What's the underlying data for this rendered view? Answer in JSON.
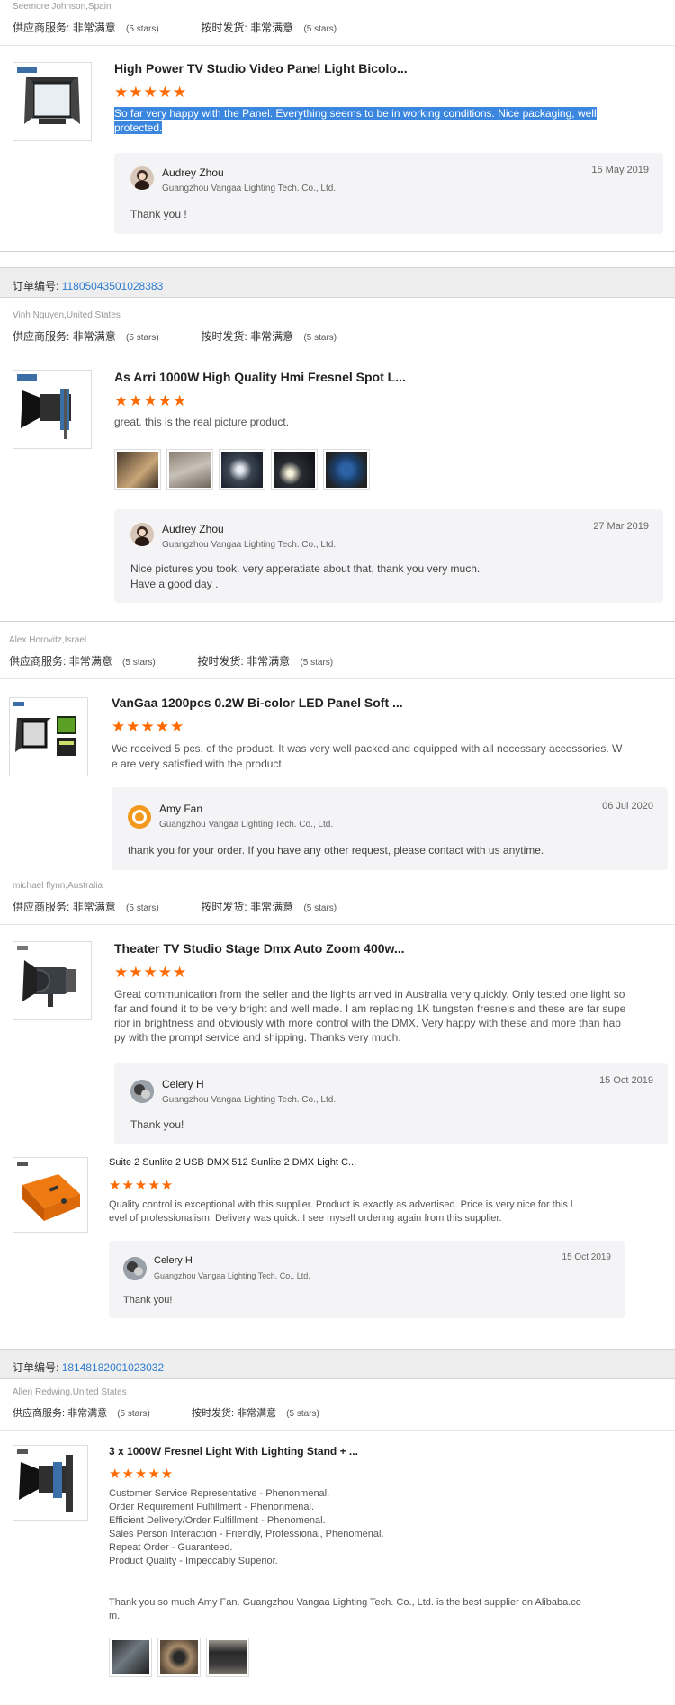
{
  "ratings_labels": {
    "supplier_service": "供应商服务:",
    "on_time": "按时发货:",
    "very_satisfied": "非常满意",
    "stars": "(5 stars)"
  },
  "order_label": "订单编号:",
  "stars_glyphs": "★★★★★",
  "reviews": [
    {
      "buyer": "Seemore Johnson,Spain",
      "title": "High Power TV Studio Video Panel Light Bicolo...",
      "text": "So far very happy with the Panel. Everything seems to be in working conditions. Nice packaging, well protected.",
      "reply": {
        "name": "Audrey Zhou",
        "company": "Guangzhou Vangaa Lighting Tech. Co., Ltd.",
        "date": "15 May 2019",
        "message": "Thank  you !"
      }
    },
    {
      "order_number": "11805043501028383",
      "buyer": "Vinh Nguyen,United States",
      "title": "As Arri 1000W High Quality Hmi Fresnel Spot L...",
      "text": "great. this is the real picture product.",
      "reply": {
        "name": "Audrey Zhou",
        "company": "Guangzhou Vangaa Lighting Tech. Co., Ltd.",
        "date": "27 Mar 2019",
        "message_1": "Nice pictures you took.  very apperatiate about that, thank you very much.",
        "message_2": "Have a good day ."
      }
    },
    {
      "buyer": "Alex Horovitz,Israel",
      "title": "VanGaa 1200pcs 0.2W Bi-color LED Panel Soft ...",
      "text_1": "We received 5 pcs. of the product. It was very well packed and equipped with all necessary accessories. W",
      "text_2": "e are very satisfied with the product.",
      "reply": {
        "name": "Amy Fan",
        "company": "Guangzhou Vangaa Lighting Tech. Co., Ltd.",
        "date": "06 Jul 2020",
        "message": "thank you for your order. If you have any other request, please contact with us anytime."
      }
    },
    {
      "buyer": "michael flynn,Australia",
      "title": "Theater TV Studio Stage Dmx Auto Zoom 400w...",
      "text_1": "Great communication from the seller and the lights arrived in Australia very quickly. Only tested one light so",
      "text_2": "far and found it to be very bright and well made. I am replacing 1K tungsten fresnels and these are far supe",
      "text_3": "rior in brightness and obviously with more control with the DMX. Very happy with these and more than hap",
      "text_4": "py with the prompt service and shipping. Thanks very much.",
      "reply": {
        "name": "Celery H",
        "company": "Guangzhou Vangaa Lighting Tech. Co., Ltd.",
        "date": "15 Oct 2019",
        "message": "Thank you!"
      }
    },
    {
      "title": "Suite 2 Sunlite 2 USB DMX 512 Sunlite 2 DMX Light C...",
      "text_1": "Quality control is exceptional with this supplier. Product is exactly as advertised. Price is very nice for this l",
      "text_2": "evel of professionalism. Delivery was quick. I see myself ordering again from this supplier.",
      "reply": {
        "name": "Celery H",
        "company": "Guangzhou Vangaa Lighting Tech. Co., Ltd.",
        "date": "15 Oct 2019",
        "message": "Thank you!"
      }
    },
    {
      "order_number": "18148182001023032",
      "buyer": "Allen Redwing,United States",
      "title": "3 x 1000W Fresnel Light With Lighting Stand + ...",
      "lines": [
        "Customer Service Representative - Phenonmenal.",
        "Order Requirement Fulfillment - Phenonmenal.",
        "Efficient Delivery/Order Fulfillment - Phenomenal.",
        "Sales Person Interaction - Friendly, Professional, Phenomenal.",
        "Repeat Order - Guaranteed.",
        "Product Quality - Impeccably Superior."
      ],
      "thanks_1": "Thank you so much Amy Fan. Guangzhou Vangaa Lighting Tech. Co., Ltd. is the best supplier on Alibaba.co",
      "thanks_2": "m."
    }
  ],
  "colors": {
    "star": "#ff6a00",
    "order_link": "#2e7bcf",
    "highlight": "#3b87e0"
  }
}
